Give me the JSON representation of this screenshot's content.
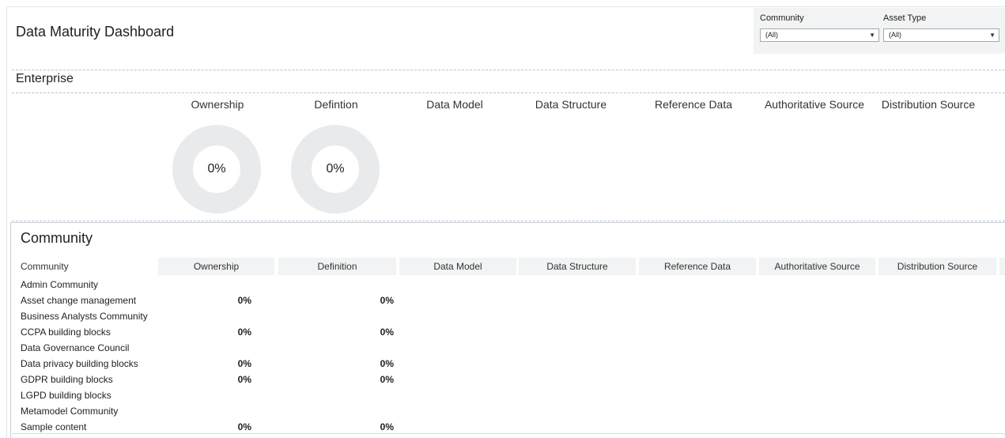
{
  "dashboard": {
    "title": "Data Maturity Dashboard"
  },
  "filters": [
    {
      "label": "Community",
      "value": "(All)"
    },
    {
      "label": "Asset Type",
      "value": "(All)"
    }
  ],
  "enterprise": {
    "title": "Enterprise",
    "columns": [
      "Ownership",
      "Defintion",
      "Data Model",
      "Data Structure",
      "Reference Data",
      "Authoritative Source",
      "Distribution Source"
    ],
    "donuts": [
      {
        "metric": "Ownership",
        "percent_label": "0%",
        "value": 0
      },
      {
        "metric": "Defintion",
        "percent_label": "0%",
        "value": 0
      }
    ]
  },
  "community": {
    "title": "Community",
    "columns": [
      "Community",
      "Ownership",
      "Definition",
      "Data Model",
      "Data Structure",
      "Reference Data",
      "Authoritative Source",
      "Distribution Source"
    ],
    "rows": [
      {
        "name": "Admin Community",
        "ownership": "",
        "definition": ""
      },
      {
        "name": "Asset change management",
        "ownership": "0%",
        "definition": "0%"
      },
      {
        "name": "Business Analysts Community",
        "ownership": "",
        "definition": ""
      },
      {
        "name": "CCPA building blocks",
        "ownership": "0%",
        "definition": "0%"
      },
      {
        "name": "Data Governance Council",
        "ownership": "",
        "definition": ""
      },
      {
        "name": "Data privacy building blocks",
        "ownership": "0%",
        "definition": "0%"
      },
      {
        "name": "GDPR building blocks",
        "ownership": "0%",
        "definition": "0%"
      },
      {
        "name": "LGPD building blocks",
        "ownership": "",
        "definition": ""
      },
      {
        "name": "Metamodel Community",
        "ownership": "",
        "definition": ""
      },
      {
        "name": "Sample content",
        "ownership": "0%",
        "definition": "0%"
      }
    ]
  },
  "icons": {
    "dropdown": "chevron-down-icon"
  },
  "colors": {
    "donut_empty": "#e8eaec",
    "header_shade": "#f2f3f4",
    "divider": "#b9c7d6"
  }
}
